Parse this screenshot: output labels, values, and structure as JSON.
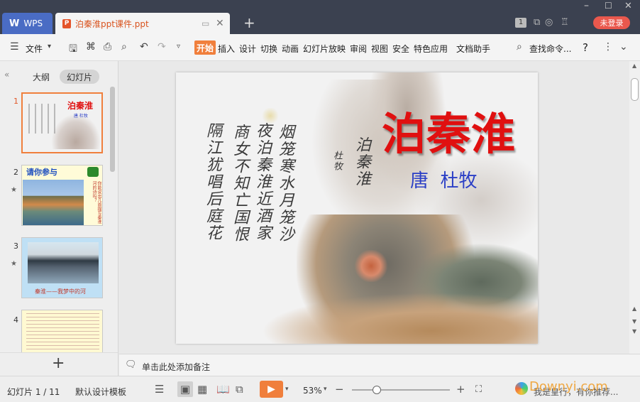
{
  "titlebar": {
    "app_tab": "WPS",
    "doc_tab": "泊秦淮ppt课件.ppt",
    "page_badge": "1",
    "login": "未登录"
  },
  "menubar": {
    "file": "文件",
    "tabs": [
      "开始",
      "插入",
      "设计",
      "切换",
      "动画",
      "幻灯片放映",
      "审阅",
      "视图",
      "安全",
      "特色应用",
      "文档助手"
    ],
    "search": "查找命令...",
    "help": "?"
  },
  "leftpanel": {
    "tab_outline": "大纲",
    "tab_slides": "幻灯片",
    "thumbs": [
      {
        "num": "1",
        "title": "泊秦淮",
        "author": "唐 杜牧"
      },
      {
        "num": "2",
        "title": "请你参与",
        "side_text": "你能说出几首描写秦淮河的诗吗？"
      },
      {
        "num": "3",
        "caption": "秦淮——我梦中的河"
      },
      {
        "num": "4"
      }
    ],
    "add": "+"
  },
  "slide": {
    "title": "泊秦淮",
    "author": "唐  杜牧",
    "poem_cols": [
      "烟笼寒水月笼沙",
      "夜泊秦淮近酒家",
      "商女不知亡国恨",
      "隔江犹唱后庭花"
    ],
    "poem_title": "泊秦淮",
    "poem_author": "杜牧"
  },
  "notes": {
    "placeholder": "单击此处添加备注"
  },
  "status": {
    "slide_info": "幻灯片 1 / 11",
    "template": "默认设计模板",
    "zoom": "53%",
    "zoom_level": 0.25,
    "watermark": "Downyi.com",
    "notice": "我是皇行，有你推荐..."
  },
  "colors": {
    "titlebar": "#3b4150",
    "wps_tab": "#4a6cc4",
    "accent": "#f07f3c",
    "slide_title": "#e01010",
    "slide_author": "#2b3fc6"
  }
}
